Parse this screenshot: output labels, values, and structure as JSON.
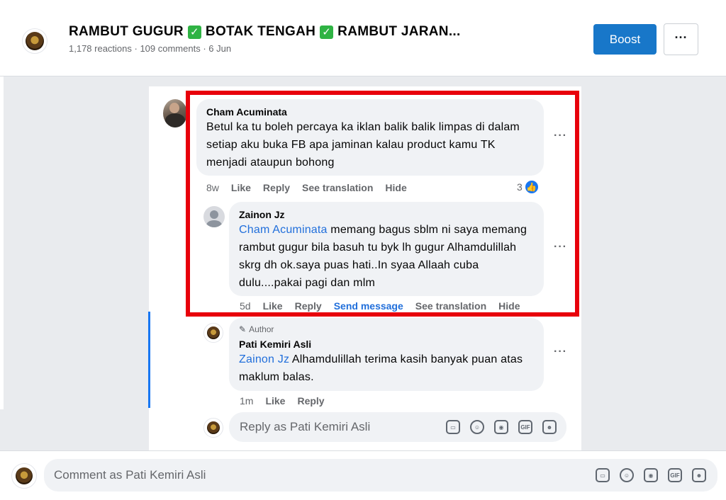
{
  "post": {
    "title_parts": [
      "RAMBUT GUGUR",
      "BOTAK TENGAH",
      "RAMBUT JARAN..."
    ],
    "check_glyph": "✓",
    "meta": "1,178 reactions · 109 comments · 6 Jun",
    "boost_label": "Boost",
    "more_label": "···"
  },
  "comments": [
    {
      "name": "Cham Acuminata",
      "text": "Betul ka tu boleh percaya ka iklan balik balik limpas di dalam setiap aku buka FB apa jaminan kalau product kamu TK menjadi ataupun bohong",
      "time": "8w",
      "like": "Like",
      "reply": "Reply",
      "translate": "See translation",
      "hide": "Hide",
      "reaction_count": "3",
      "more": "···"
    },
    {
      "name": "Zainon Jz",
      "mention": "Cham Acuminata",
      "text": " memang bagus sblm ni saya memang rambut gugur bila basuh tu byk lh gugur Alhamdulillah skrg dh ok.saya puas hati..In syaa Allaah cuba dulu....pakai pagi dan mlm",
      "time": "5d",
      "like": "Like",
      "reply": "Reply",
      "send_message": "Send message",
      "translate": "See translation",
      "hide": "Hide",
      "more": "···"
    },
    {
      "author_tag": "Author",
      "name": "Pati Kemiri Asli",
      "mention": "Zainon Jz",
      "text": " Alhamdulillah terima kasih banyak puan atas maklum balas.",
      "time": "1m",
      "like": "Like",
      "reply": "Reply",
      "more": "···"
    }
  ],
  "reply_box": {
    "placeholder": "Reply as Pati Kemiri Asli",
    "icons": [
      "sticker-icon",
      "emoji-icon",
      "camera-icon",
      "gif-icon",
      "avatar-sticker-icon"
    ]
  },
  "comment_box": {
    "placeholder": "Comment as Pati Kemiri Asli"
  },
  "icon_labels": {
    "gif": "GIF"
  },
  "colors": {
    "accent": "#1877c9",
    "mention": "#216fdb",
    "highlight": "#e8000b",
    "check": "#2fb344"
  }
}
